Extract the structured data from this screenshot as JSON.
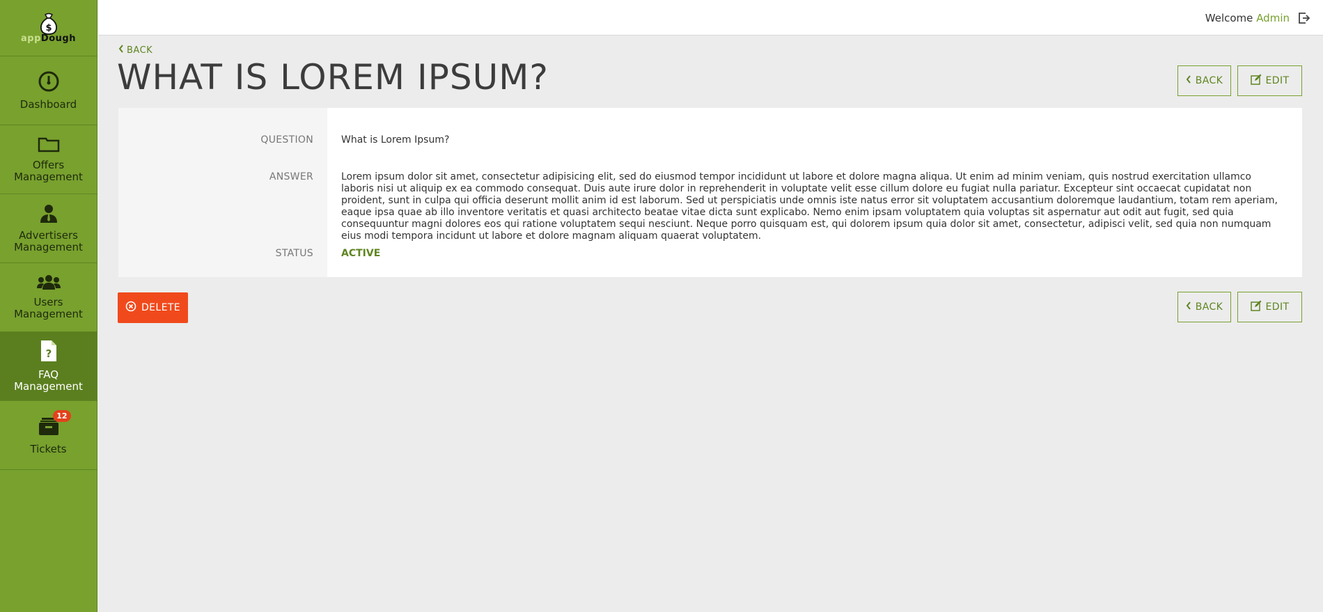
{
  "app": {
    "logo_prefix": "app",
    "logo_suffix": "Dough"
  },
  "sidebar": {
    "items": [
      {
        "label": "Dashboard",
        "icon": "gauge-icon"
      },
      {
        "label": "Offers Management",
        "icon": "folder-icon"
      },
      {
        "label": "Advertisers Management",
        "icon": "businessman-icon"
      },
      {
        "label": "Users Management",
        "icon": "users-icon"
      },
      {
        "label": "FAQ Management",
        "icon": "question-file-icon",
        "active": true
      },
      {
        "label": "Tickets",
        "icon": "inbox-icon",
        "badge": "12"
      }
    ]
  },
  "topbar": {
    "welcome": "Welcome",
    "user": "Admin"
  },
  "breadcrumb": {
    "back_label": "BACK"
  },
  "page": {
    "title": "WHAT IS LOREM IPSUM?"
  },
  "buttons": {
    "back": "BACK",
    "edit": "EDIT",
    "delete": "DELETE"
  },
  "detail": {
    "question_label": "QUESTION",
    "question": "What is Lorem Ipsum?",
    "answer_label": "ANSWER",
    "answer": "Lorem ipsum dolor sit amet, consectetur adipisicing elit, sed do eiusmod tempor incididunt ut labore et dolore magna aliqua. Ut enim ad minim veniam, quis nostrud exercitation ullamco laboris nisi ut aliquip ex ea commodo consequat. Duis aute irure dolor in reprehenderit in voluptate velit esse cillum dolore eu fugiat nulla pariatur. Excepteur sint occaecat cupidatat non proident, sunt in culpa qui officia deserunt mollit anim id est laborum. Sed ut perspiciatis unde omnis iste natus error sit voluptatem accusantium doloremque laudantium, totam rem aperiam, eaque ipsa quae ab illo inventore veritatis et quasi architecto beatae vitae dicta sunt explicabo. Nemo enim ipsam voluptatem quia voluptas sit aspernatur aut odit aut fugit, sed quia consequuntur magni dolores eos qui ratione voluptatem sequi nesciunt. Neque porro quisquam est, qui dolorem ipsum quia dolor sit amet, consectetur, adipisci velit, sed quia non numquam eius modi tempora incidunt ut labore et dolore magnam aliquam quaerat voluptatem.",
    "status_label": "STATUS",
    "status": "ACTIVE"
  },
  "colors": {
    "brand": "#78a12e",
    "brand_dark": "#5b7f1f",
    "danger": "#f04a1c"
  }
}
